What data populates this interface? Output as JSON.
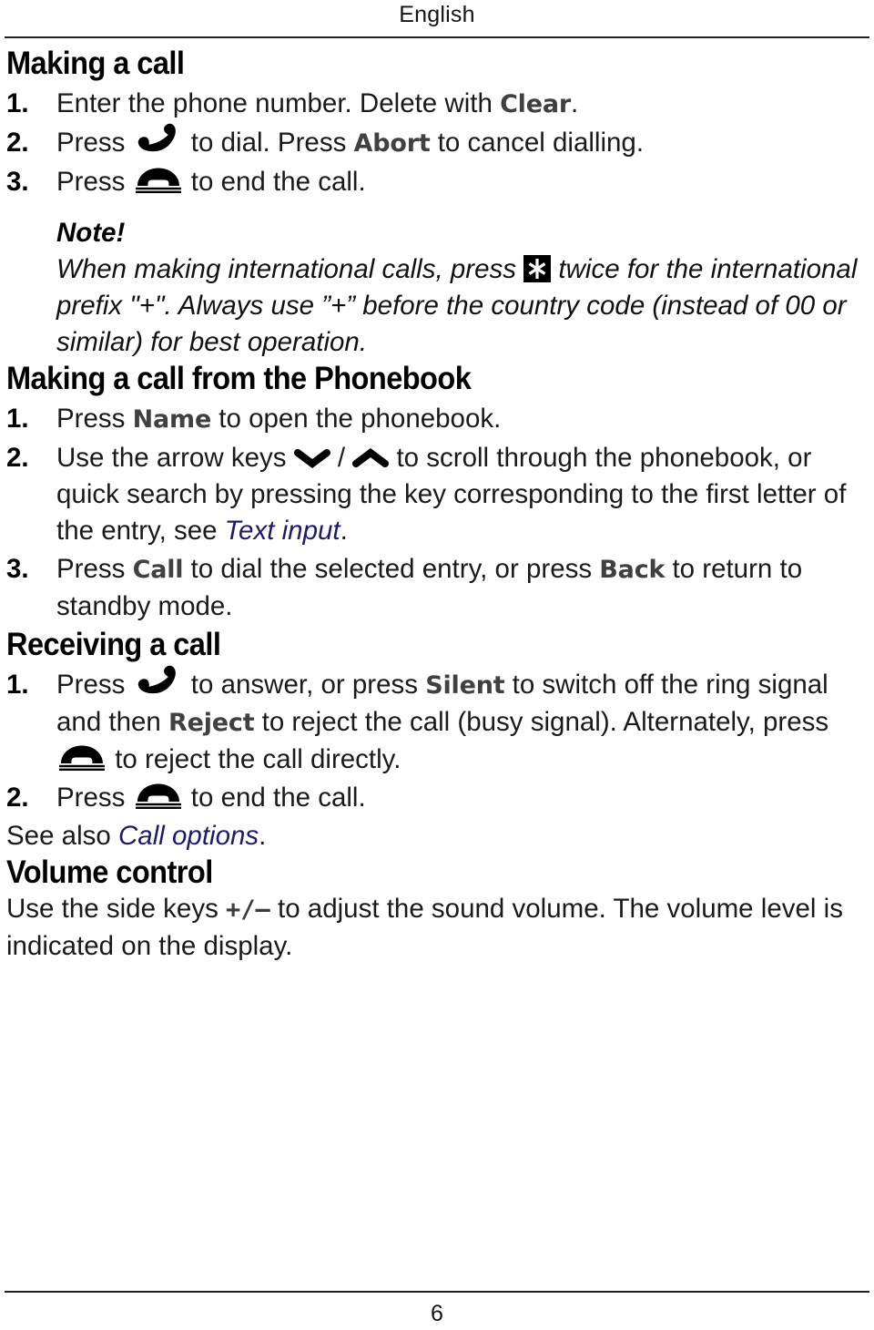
{
  "page": {
    "running_head": "English",
    "folio": "6",
    "accent_xref_color": "#1b1b6b",
    "keyword_color": "#404040",
    "rule_color": "#231f20"
  },
  "sections": [
    {
      "id": "making-a-call",
      "heading": "Making a call",
      "steps": [
        {
          "num": "1.",
          "parts": [
            {
              "t": "text",
              "v": "Enter the phone number. Delete with "
            },
            {
              "t": "kw",
              "v": "Clear"
            },
            {
              "t": "text",
              "v": "."
            }
          ]
        },
        {
          "num": "2.",
          "parts": [
            {
              "t": "text",
              "v": "Press "
            },
            {
              "t": "icon",
              "v": "handset-offhook-icon"
            },
            {
              "t": "text",
              "v": " to dial. Press "
            },
            {
              "t": "kw",
              "v": "Abort"
            },
            {
              "t": "text",
              "v": " to cancel dialling."
            }
          ]
        },
        {
          "num": "3.",
          "parts": [
            {
              "t": "text",
              "v": "Press "
            },
            {
              "t": "icon",
              "v": "handset-oncradle-icon"
            },
            {
              "t": "text",
              "v": " to end the call."
            }
          ]
        }
      ]
    },
    {
      "id": "making-a-call-from-the-phonebook",
      "heading": "Making a call from the Phonebook",
      "steps": [
        {
          "num": "1.",
          "parts": [
            {
              "t": "text",
              "v": "Press "
            },
            {
              "t": "kw",
              "v": "Name"
            },
            {
              "t": "text",
              "v": " to open the phonebook."
            }
          ]
        },
        {
          "num": "2.",
          "parts": [
            {
              "t": "text",
              "v": "Use the arrow keys "
            },
            {
              "t": "icon",
              "v": "chevron-down-icon"
            },
            {
              "t": "text",
              "v": " / "
            },
            {
              "t": "icon",
              "v": "chevron-up-icon"
            },
            {
              "t": "text",
              "v": " to scroll through the phonebook, or quick search by pressing the key corresponding to the first letter of the entry, see "
            },
            {
              "t": "xref",
              "v": "Text input"
            },
            {
              "t": "text",
              "v": "."
            }
          ]
        },
        {
          "num": "3.",
          "parts": [
            {
              "t": "text",
              "v": "Press "
            },
            {
              "t": "kw",
              "v": "Call"
            },
            {
              "t": "text",
              "v": " to dial the selected entry, or press "
            },
            {
              "t": "kw",
              "v": "Back"
            },
            {
              "t": "text",
              "v": " to return to standby mode."
            }
          ]
        }
      ]
    },
    {
      "id": "receiving-a-call",
      "heading": "Receiving a call",
      "steps": [
        {
          "num": "1.",
          "parts": [
            {
              "t": "text",
              "v": "Press "
            },
            {
              "t": "icon",
              "v": "handset-offhook-icon"
            },
            {
              "t": "text",
              "v": " to answer, or press "
            },
            {
              "t": "kw",
              "v": "Silent"
            },
            {
              "t": "text",
              "v": " to switch off the ring signal and then "
            },
            {
              "t": "kw",
              "v": "Reject"
            },
            {
              "t": "text",
              "v": " to reject the call (busy signal). Alternately, press "
            },
            {
              "t": "icon",
              "v": "handset-oncradle-icon"
            },
            {
              "t": "text",
              "v": " to reject the call directly."
            }
          ]
        },
        {
          "num": "2.",
          "parts": [
            {
              "t": "text",
              "v": "Press "
            },
            {
              "t": "icon",
              "v": "handset-oncradle-icon"
            },
            {
              "t": "text",
              "v": " to end the call."
            }
          ]
        }
      ]
    },
    {
      "id": "volume-control",
      "heading": "Volume control",
      "steps": []
    }
  ],
  "note": {
    "label": "Note!",
    "parts": [
      {
        "t": "text",
        "v": "When making international calls, press "
      },
      {
        "t": "icon",
        "v": "star-key-icon"
      },
      {
        "t": "text",
        "v": " twice for the international prefix \"+\". Always use ”+” before the country code (instead of 00 or similar) for best operation."
      }
    ]
  },
  "see_also": {
    "parts": [
      {
        "t": "text",
        "v": "See also "
      },
      {
        "t": "xref",
        "v": "Call options"
      },
      {
        "t": "text",
        "v": "."
      }
    ]
  },
  "volume_body": {
    "parts": [
      {
        "t": "text",
        "v": "Use the side keys "
      },
      {
        "t": "mono",
        "v": "+/–"
      },
      {
        "t": "text",
        "v": " to adjust the sound volume. The volume level is indicated on the display."
      }
    ]
  }
}
